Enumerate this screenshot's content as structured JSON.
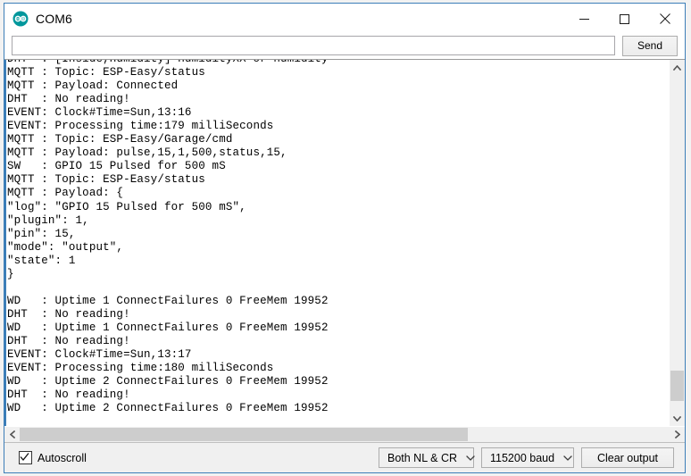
{
  "window": {
    "title": "COM6",
    "app_icon": "arduino-infinity-icon",
    "icon_color": "#00979c",
    "accent_border": "#3c7eb8",
    "controls": {
      "minimize": "minimize-icon",
      "maximize": "maximize-icon",
      "close": "close-icon"
    }
  },
  "send_row": {
    "input_value": "",
    "input_placeholder": "",
    "send_label": "Send"
  },
  "console": {
    "lines": [
      "DHT  : [Inside,Humidity] HumidityXX or humidity",
      "MQTT : Topic: ESP-Easy/status",
      "MQTT : Payload: Connected",
      "DHT  : No reading!",
      "EVENT: Clock#Time=Sun,13:16",
      "EVENT: Processing time:179 milliSeconds",
      "MQTT : Topic: ESP-Easy/Garage/cmd",
      "MQTT : Payload: pulse,15,1,500,status,15,",
      "SW   : GPIO 15 Pulsed for 500 mS",
      "MQTT : Topic: ESP-Easy/status",
      "MQTT : Payload: {",
      "\"log\": \"GPIO 15 Pulsed for 500 mS\",",
      "\"plugin\": 1,",
      "\"pin\": 15,",
      "\"mode\": \"output\",",
      "\"state\": 1",
      "}",
      "",
      "WD   : Uptime 1 ConnectFailures 0 FreeMem 19952",
      "DHT  : No reading!",
      "WD   : Uptime 1 ConnectFailures 0 FreeMem 19952",
      "DHT  : No reading!",
      "EVENT: Clock#Time=Sun,13:17",
      "EVENT: Processing time:180 milliSeconds",
      "WD   : Uptime 2 ConnectFailures 0 FreeMem 19952",
      "DHT  : No reading!",
      "WD   : Uptime 2 ConnectFailures 0 FreeMem 19952"
    ],
    "vscroll": {
      "up_arrow": "chevron-up-icon",
      "down_arrow": "chevron-down-icon",
      "thumb_top_pct": 88,
      "thumb_height_pct": 9
    },
    "hscroll": {
      "left_arrow": "chevron-left-icon",
      "right_arrow": "chevron-right-icon",
      "thumb_left_pct": 0,
      "thumb_width_pct": 69
    }
  },
  "bottom_bar": {
    "autoscroll_label": "Autoscroll",
    "autoscroll_checked": true,
    "line_ending": "Both NL & CR",
    "baud_rate": "115200 baud",
    "clear_label": "Clear output",
    "dropdown_icon": "chevron-down-icon"
  }
}
